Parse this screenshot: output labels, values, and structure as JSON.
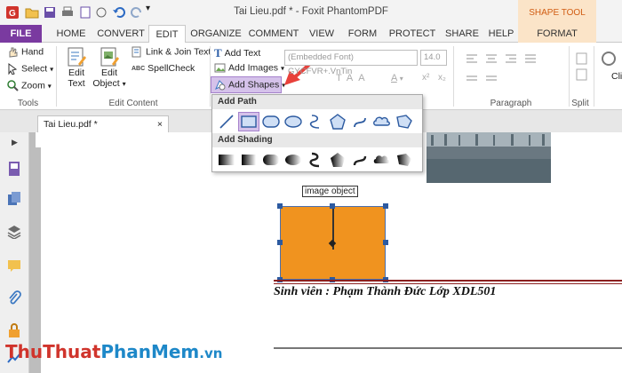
{
  "window": {
    "title": "Tai Lieu.pdf * - Foxit PhantomPDF"
  },
  "contextual_tab_group": "SHAPE TOOL",
  "tabs": [
    "FILE",
    "HOME",
    "CONVERT",
    "EDIT",
    "ORGANIZE",
    "COMMENT",
    "VIEW",
    "FORM",
    "PROTECT",
    "SHARE",
    "HELP",
    "FORMAT"
  ],
  "ribbon": {
    "tools": {
      "hand": "Hand",
      "select": "Select",
      "zoom": "Zoom",
      "group": "Tools"
    },
    "edit_content": {
      "edit_text": [
        "Edit",
        "Text"
      ],
      "edit_object": [
        "Edit",
        "Object"
      ],
      "link_join": "Link & Join Text",
      "spellcheck": "SpellCheck",
      "group": "Edit Content"
    },
    "add": {
      "add_text": "Add Text",
      "add_images": "Add Images",
      "add_shapes": "Add Shapes"
    },
    "font": {
      "font_name": "(Embedded Font) GYCFVR+.VnTin",
      "font_size": "14.0"
    },
    "paragraph_group": "Paragraph",
    "split_group": "Split",
    "right_cut": "Cli"
  },
  "document": {
    "tab_label": "Tai Lieu.pdf *",
    "close": "×"
  },
  "shapes_dropdown": {
    "add_path": "Add Path",
    "add_shading": "Add Shading"
  },
  "page": {
    "tooltip": "image object",
    "student_line": "Sinh viên : Phạm Thành Đức Lớp XDL501",
    "shape_fill": "#f0931f"
  },
  "watermark": {
    "part1": "Thu",
    "part2": "Thuat",
    "part3": "Phan",
    "part4": "Mem",
    "part5": ".vn"
  },
  "colors": {
    "accent": "#7a3aa0",
    "shape_tool": "#d15d13",
    "arrow": "#e8413b"
  }
}
